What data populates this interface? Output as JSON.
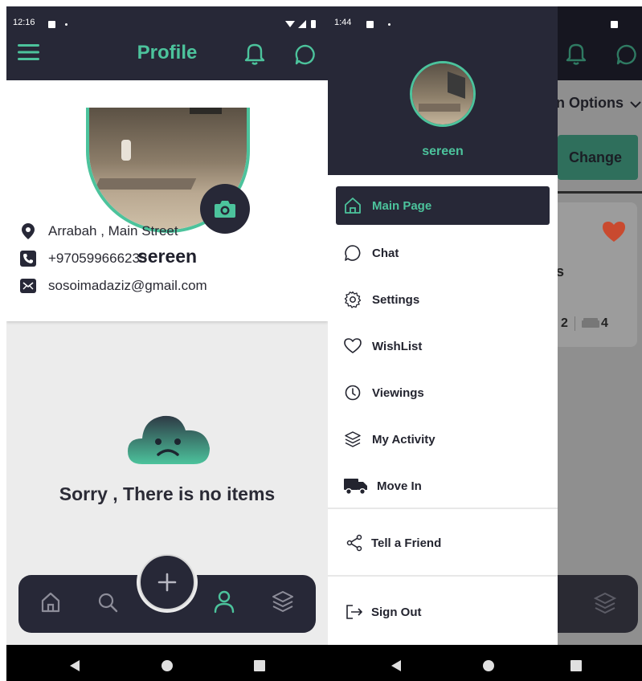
{
  "left": {
    "status": {
      "time": "12:16"
    },
    "header": {
      "title": "Profile",
      "menu_icon": "hamburger-icon",
      "bell_icon": "bell-icon",
      "chat_icon": "chat-bubble-icon"
    },
    "profile": {
      "username": "sereen",
      "address": "Arrabah , Main Street",
      "phone": "+970599666233",
      "email": "sosoimadaziz@gmail.com"
    },
    "empty_state": {
      "message": "Sorry , There is no items",
      "icon": "sad-cloud-icon"
    },
    "bottom_nav": {
      "items": [
        "home-icon",
        "search-icon",
        "add-icon",
        "person-icon",
        "layers-icon"
      ],
      "active": "person-icon"
    }
  },
  "right": {
    "status": {
      "time": "1:44"
    },
    "background": {
      "options_label": "n Options",
      "change_button": "Change",
      "stat_a": "2",
      "stat_b": "4",
      "partial_text": "s"
    },
    "drawer": {
      "username": "sereen",
      "menu": [
        {
          "label": "Main Page",
          "icon": "home-icon",
          "active": true
        },
        {
          "label": "Chat",
          "icon": "chat-bubble-icon"
        },
        {
          "label": "Settings",
          "icon": "gear-icon"
        },
        {
          "label": "WishList",
          "icon": "heart-icon"
        },
        {
          "label": "Viewings",
          "icon": "clock-icon"
        },
        {
          "label": "My Activity",
          "icon": "layers-icon"
        },
        {
          "label": "Move In",
          "icon": "truck-icon"
        }
      ],
      "tell_friend": "Tell a Friend",
      "sign_out": "Sign Out"
    }
  },
  "colors": {
    "accent": "#4cc39c",
    "dark": "#272837",
    "heart": "#d85a3c"
  }
}
